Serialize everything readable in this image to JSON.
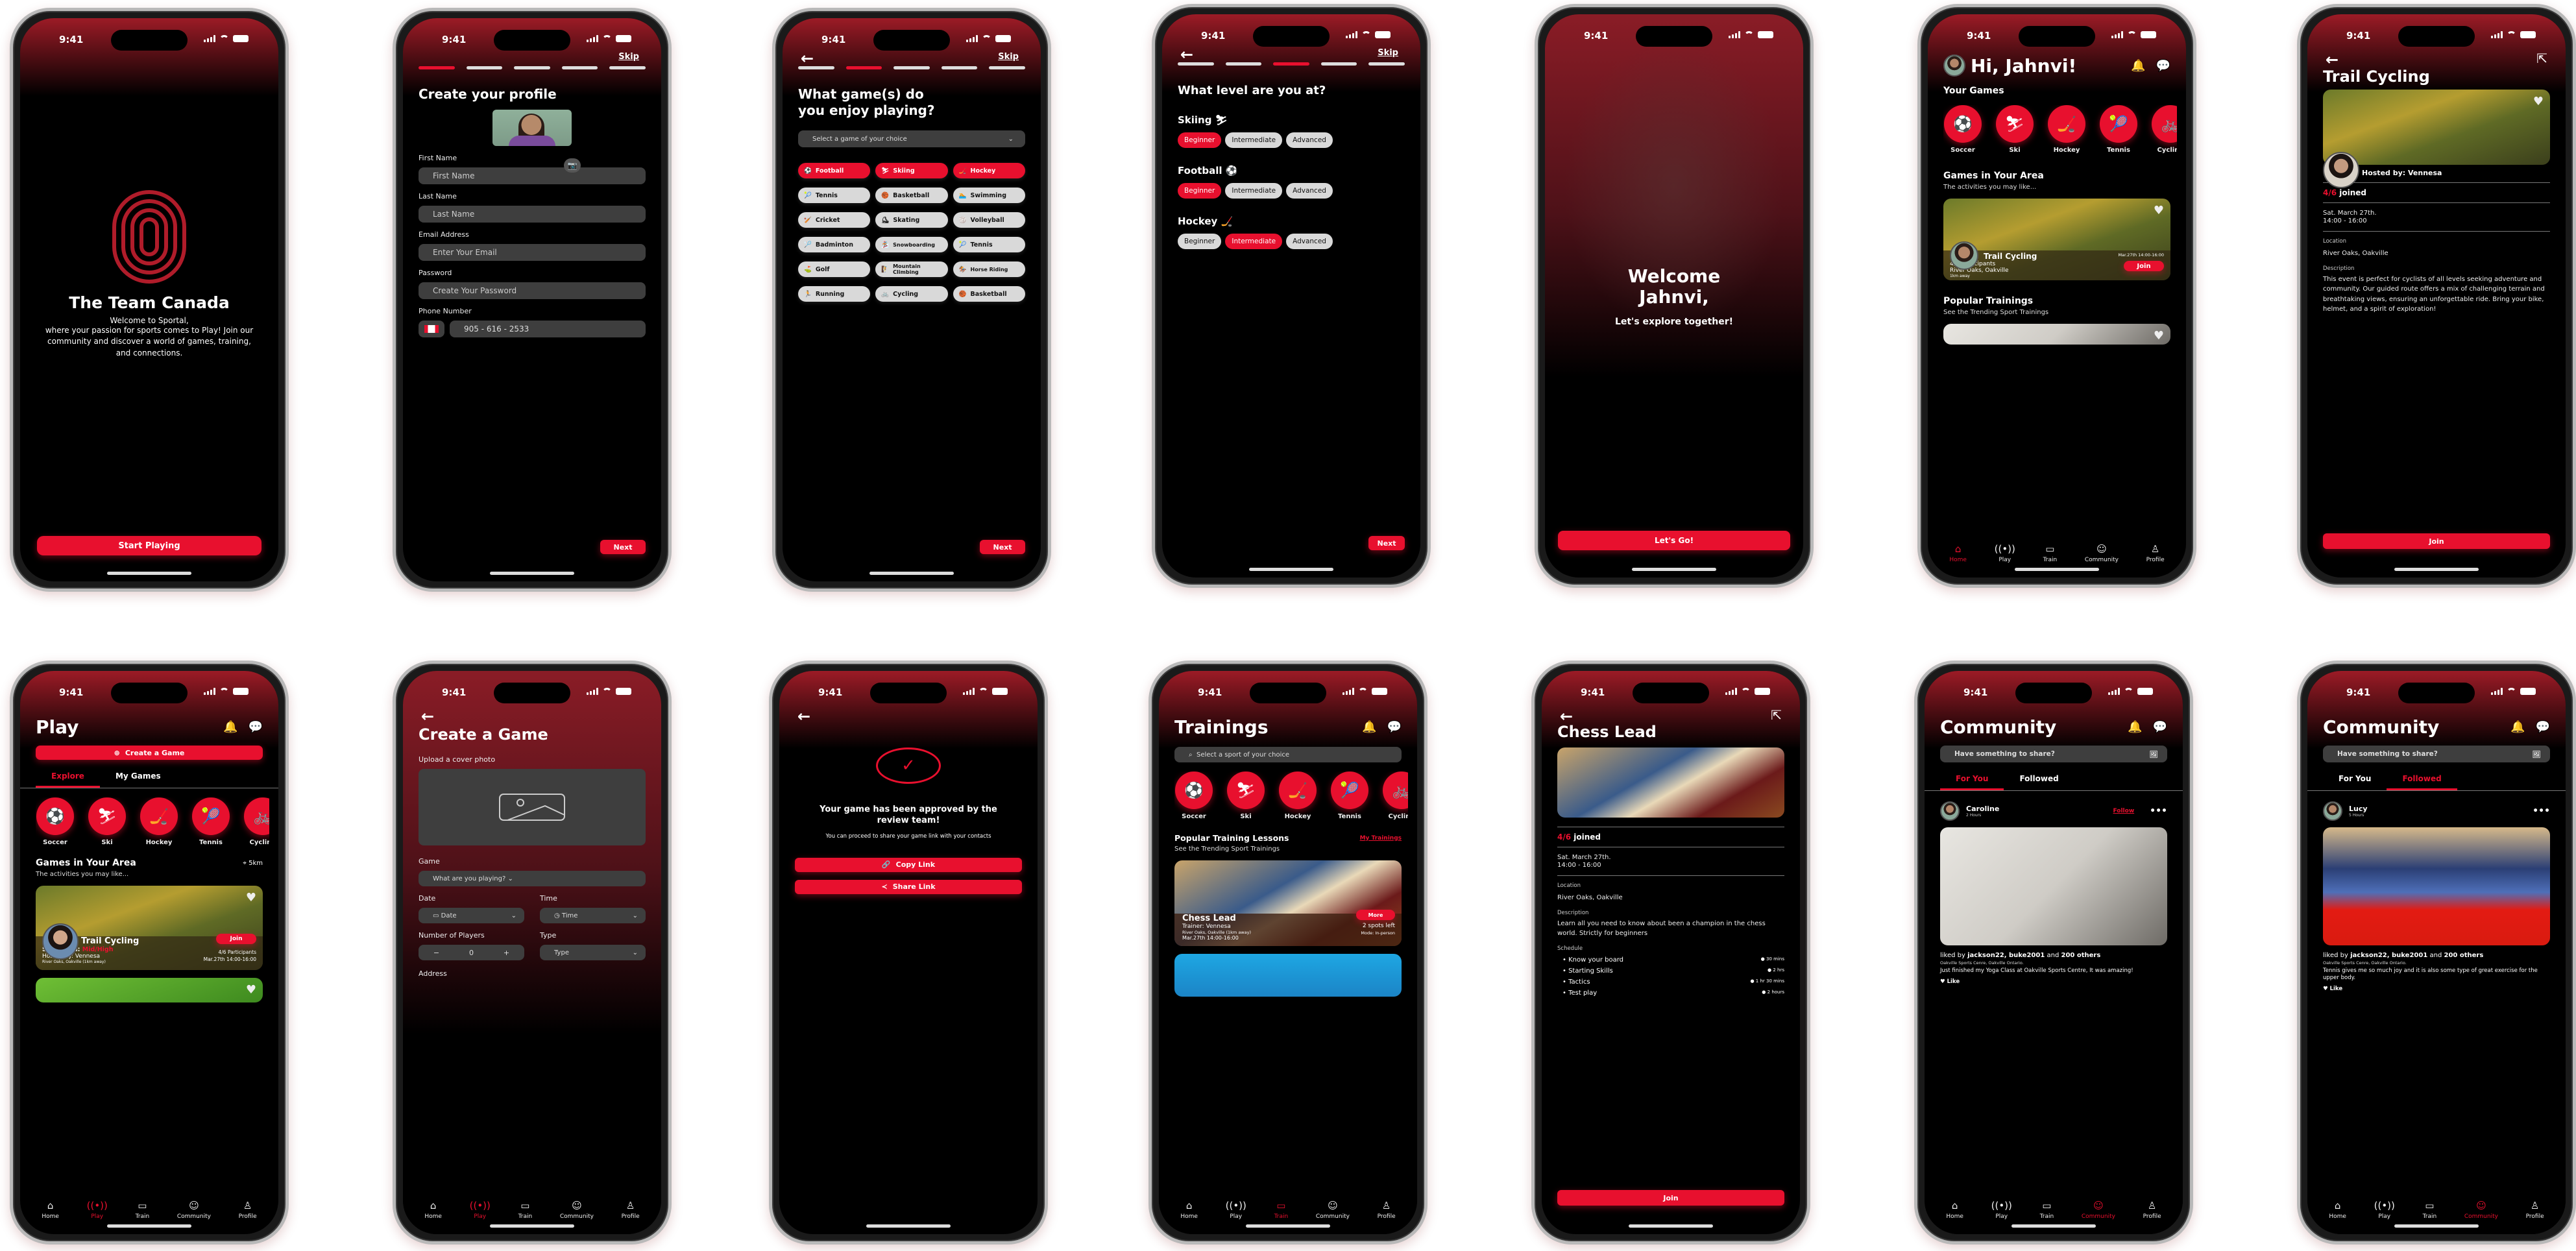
{
  "status_time": "9:41",
  "colors": {
    "accent": "#e8102e",
    "header_gradient": "#9c1b26",
    "background": "#000000",
    "field": "#3e3e3e",
    "chip": "#d9d9d9"
  },
  "tabbar": [
    {
      "icon": "home-icon",
      "label": "Home"
    },
    {
      "icon": "play-broadcast-icon",
      "label": "Play"
    },
    {
      "icon": "train-icon",
      "label": "Train"
    },
    {
      "icon": "community-icon",
      "label": "Community"
    },
    {
      "icon": "profile-icon",
      "label": "Profile"
    }
  ],
  "sports_row": [
    {
      "icon": "soccer-icon",
      "glyph": "⚽",
      "label": "Soccer"
    },
    {
      "icon": "ski-icon",
      "glyph": "⛷",
      "label": "Ski"
    },
    {
      "icon": "hockey-icon",
      "glyph": "🏒",
      "label": "Hockey"
    },
    {
      "icon": "tennis-icon",
      "glyph": "🎾",
      "label": "Tennis"
    },
    {
      "icon": "cycling-icon",
      "glyph": "🚲",
      "label": "Cycling"
    }
  ],
  "splash": {
    "title": "The Team Canada",
    "welcome": "Welcome to Sportal,",
    "body": "where your passion for sports comes to Play! Join our community and discover a world of games, training, and connections.",
    "cta": "Start Playing"
  },
  "profile": {
    "skip": "Skip",
    "title": "Create your profile",
    "fields": [
      {
        "label": "First Name",
        "placeholder": "First Name"
      },
      {
        "label": "Last Name",
        "placeholder": "Last Name"
      },
      {
        "label": "Email Address",
        "placeholder": "Enter Your Email"
      },
      {
        "label": "Password",
        "placeholder": "Create Your Password"
      }
    ],
    "phone_label": "Phone Number",
    "phone_value": "905 - 616 - 2533",
    "next": "Next",
    "step": 1,
    "steps": 5
  },
  "games": {
    "skip": "Skip",
    "title": "What game(s) do you enjoy playing?",
    "select_placeholder": "Select a game of your choice",
    "chips": [
      {
        "label": "Football",
        "icon": "⚽",
        "selected": true
      },
      {
        "label": "Skiing",
        "icon": "⛷",
        "selected": true
      },
      {
        "label": "Hockey",
        "icon": "🏒",
        "selected": true
      },
      {
        "label": "Tennis",
        "icon": "🎾",
        "selected": false
      },
      {
        "label": "Basketball",
        "icon": "🏀",
        "selected": false
      },
      {
        "label": "Swimming",
        "icon": "🏊",
        "selected": false
      },
      {
        "label": "Cricket",
        "icon": "🏏",
        "selected": false
      },
      {
        "label": "Skating",
        "icon": "⛸",
        "selected": false
      },
      {
        "label": "Volleyball",
        "icon": "🏐",
        "selected": false
      },
      {
        "label": "Badminton",
        "icon": "🏸",
        "selected": false
      },
      {
        "label": "Snowboarding",
        "icon": "🏂",
        "selected": false
      },
      {
        "label": "Tennis",
        "icon": "🎾",
        "selected": false
      },
      {
        "label": "Golf",
        "icon": "⛳",
        "selected": false
      },
      {
        "label": "Mountain Climbing",
        "icon": "🧗",
        "selected": false
      },
      {
        "label": "Horse Riding",
        "icon": "🏇",
        "selected": false
      },
      {
        "label": "Running",
        "icon": "🏃",
        "selected": false
      },
      {
        "label": "Cycling",
        "icon": "🚲",
        "selected": false
      },
      {
        "label": "Basketball",
        "icon": "🏀",
        "selected": false
      }
    ],
    "next": "Next",
    "step": 2,
    "steps": 5
  },
  "level": {
    "skip": "Skip",
    "title": "What level are you at?",
    "sports": [
      {
        "name": "Skiing",
        "icon": "⛷",
        "selected": "Beginner"
      },
      {
        "name": "Football",
        "icon": "⚽",
        "selected": "Beginner"
      },
      {
        "name": "Hockey",
        "icon": "🏒",
        "selected": "Intermediate"
      }
    ],
    "levels": [
      "Beginner",
      "Intermediate",
      "Advanced"
    ],
    "next": "Next",
    "step": 3,
    "steps": 5
  },
  "welcome": {
    "title": "Welcome Jahnvi,",
    "subtitle": "Let's explore together!",
    "cta": "Let's Go!"
  },
  "home": {
    "greeting": "Hi, Jahnvi!",
    "your_games": "Your Games",
    "area_title": "Games in Your Area",
    "area_sub": "The activities you may like...",
    "card": {
      "title": "Trail Cycling",
      "participants": "4/6 Participants",
      "location": "River Oaks, Oakville",
      "distance": "1km away",
      "datetime": "Mar.27th 14:00-16:00",
      "join": "Join"
    },
    "popular_title": "Popular Trainings",
    "popular_sub": "See the Trending Sport Trainings"
  },
  "trail_detail": {
    "title": "Trail Cycling",
    "hosted_by": "Hosted by: Vennesa",
    "joined_count": "4/6",
    "joined_label": "joined",
    "date": "Sat. March 27th.",
    "time": "14:00 - 16:00",
    "location_label": "Location",
    "location": "River Oaks, Oakville",
    "description_label": "Description",
    "description": "This event is perfect for cyclists of all levels seeking adventure and community. Our guided route offers a mix of challenging terrain and breathtaking views, ensuring an unforgettable ride. Bring your bike, helmet, and a spirit of exploration!",
    "join": "Join"
  },
  "play": {
    "title": "Play",
    "create": "Create a Game",
    "tabs": [
      "Explore",
      "My Games"
    ],
    "active_tab": 0,
    "area_title": "Games in Your Area",
    "area_sub": "The activities you may like...",
    "radius": "5km",
    "card": {
      "title": "Trail Cycling",
      "skill_label": "Skill Level:",
      "skill_value": "Mid/High",
      "hosted": "Hosted by: Vennesa",
      "location": "River Oaks, Oakville (1km away)",
      "participants": "4/6 Participants",
      "datetime": "Mar.27th 14:00-16:00",
      "join": "Join"
    }
  },
  "create_game": {
    "title": "Create a Game",
    "upload_label": "Upload a cover photo",
    "game_label": "Game",
    "game_placeholder": "What are you playing?",
    "date_label": "Date",
    "date_placeholder": "Date",
    "time_label": "Time",
    "time_placeholder": "Time",
    "players_label": "Number of Players",
    "players_value": "0",
    "type_label": "Type",
    "type_placeholder": "Type",
    "address_label": "Address"
  },
  "approved": {
    "title": "Your game has been approved by the review team!",
    "body": "You can proceed to share your game link with your contacts",
    "copy": "Copy Link",
    "share": "Share Link"
  },
  "trainings": {
    "title": "Trainings",
    "search_placeholder": "Select a sport of your choice",
    "section_title": "Popular Training Lessons",
    "section_sub": "See the Trending Sport Trainings",
    "my_trainings": "My Trainings",
    "card": {
      "title": "Chess Lead",
      "trainer": "Trainer: Vennesa",
      "location": "River Oaks, Oakville (1km away)",
      "datetime": "Mar.27th 14:00-16:00",
      "more": "More",
      "spots": "2 spots left",
      "mode": "Mode: In-person"
    }
  },
  "chess_detail": {
    "title": "Chess Lead",
    "joined_count": "4/6",
    "joined_label": "joined",
    "date": "Sat. March 27th.",
    "time": "14:00 - 16:00",
    "location_label": "Location",
    "location": "River Oaks, Oakville",
    "description_label": "Description",
    "description": "Learn all you need to know about been a champion in the chess world. Strictly for beginners",
    "schedule_label": "Schedule",
    "schedule": [
      {
        "item": "Know your board",
        "duration": "30 mins"
      },
      {
        "item": "Starting Skills",
        "duration": "2 hrs"
      },
      {
        "item": "Tactics",
        "duration": "1 hr 30 mins"
      },
      {
        "item": "Test play",
        "duration": "2 hours"
      }
    ],
    "join": "Join"
  },
  "community": [
    {
      "title": "Community",
      "share_placeholder": "Have something to share?",
      "tabs": [
        "For You",
        "Followed"
      ],
      "active_tab": 0,
      "user": "Caroline",
      "ago": "2 Hours",
      "follow": "Follow",
      "liked_prefix": "liked by",
      "liked_users": "jackson22, buke2001",
      "liked_and": "and",
      "liked_others": "200 others",
      "place": "Oakville Sports Cenre, Oakville Ontario.",
      "caption": "Just finished my Yoga Class at Oakville Sports Centre, It was amazing!",
      "like": "Like"
    },
    {
      "title": "Community",
      "share_placeholder": "Have something to share?",
      "tabs": [
        "For You",
        "Followed"
      ],
      "active_tab": 1,
      "user": "Lucy",
      "ago": "5 Hours",
      "follow": "",
      "liked_prefix": "liked by",
      "liked_users": "jackson22, buke2001",
      "liked_and": "and",
      "liked_others": "200 others",
      "place": "Oakville Sports Cenre, Oakville Ontario.",
      "caption": "Tennis gives me so much joy and it is also some type of great exercise for the upper body.",
      "like": "Like"
    }
  ]
}
